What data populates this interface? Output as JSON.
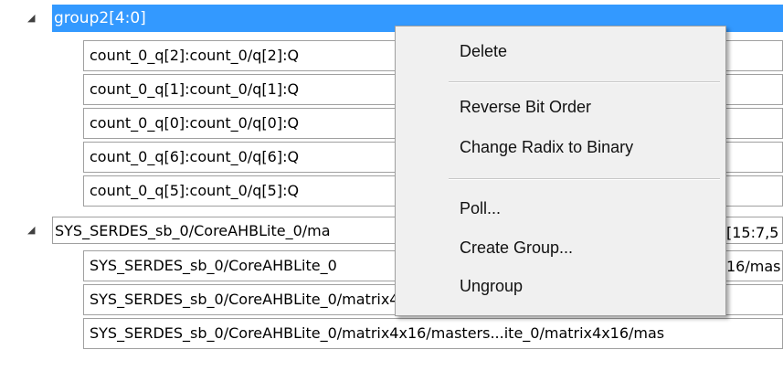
{
  "tree": {
    "group1": {
      "label": "group2[4:0]",
      "children": [
        "count_0_q[2]:count_0/q[2]:Q",
        "count_0_q[1]:count_0/q[1]:Q",
        "count_0_q[0]:count_0/q[0]:Q",
        "count_0_q[6]:count_0/q[6]:Q",
        "count_0_q[5]:count_0/q[5]:Q"
      ]
    },
    "group2": {
      "label": "SYS_SERDES_sb_0/CoreAHBLite_0/ma",
      "label_tail": "[15:7,5",
      "children": [
        {
          "text": "SYS_SERDES_sb_0/CoreAHBLite_0",
          "tail": "16/mas"
        },
        {
          "text": "SYS_SERDES_sb_0/CoreAHBLite_0/matrix4x16/masters...ite_0/matrix4x16/mas",
          "tail": ""
        },
        {
          "text": "SYS_SERDES_sb_0/CoreAHBLite_0/matrix4x16/masters...ite_0/matrix4x16/mas",
          "tail": ""
        }
      ]
    }
  },
  "context_menu": {
    "items": [
      "Delete",
      "Reverse Bit Order",
      "Change Radix to Binary",
      "Poll...",
      "Create Group...",
      "Ungroup"
    ]
  },
  "colors": {
    "selection": "#3399ff",
    "menu_bg": "#f0f0f0"
  }
}
